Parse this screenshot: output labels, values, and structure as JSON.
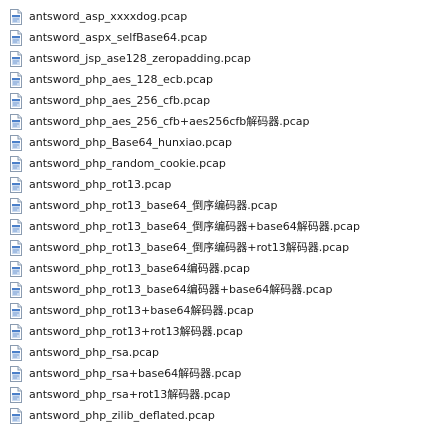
{
  "file_list": {
    "icon": "generic-file-icon",
    "files": [
      "antsword_asp_xxxxdog.pcap",
      "antsword_aspx_selfBase64.pcap",
      "antsword_jsp_ase128_zeropadding.pcap",
      "antsword_php_aes_128_ecb.pcap",
      "antsword_php_aes_256_cfb.pcap",
      "antsword_php_aes_256_cfb+aes256cfb解码器.pcap",
      "antsword_php_Base64_hunxiao.pcap",
      "antsword_php_random_cookie.pcap",
      "antsword_php_rot13.pcap",
      "antsword_php_rot13_base64_倒序编码器.pcap",
      "antsword_php_rot13_base64_倒序编码器+base64解码器.pcap",
      "antsword_php_rot13_base64_倒序编码器+rot13解码器.pcap",
      "antsword_php_rot13_base64编码器.pcap",
      "antsword_php_rot13_base64编码器+base64解码器.pcap",
      "antsword_php_rot13+base64解码器.pcap",
      "antsword_php_rot13+rot13解码器.pcap",
      "antsword_php_rsa.pcap",
      "antsword_php_rsa+base64解码器.pcap",
      "antsword_php_rsa+rot13解码器.pcap",
      "antsword_php_zilib_deflated.pcap"
    ]
  }
}
